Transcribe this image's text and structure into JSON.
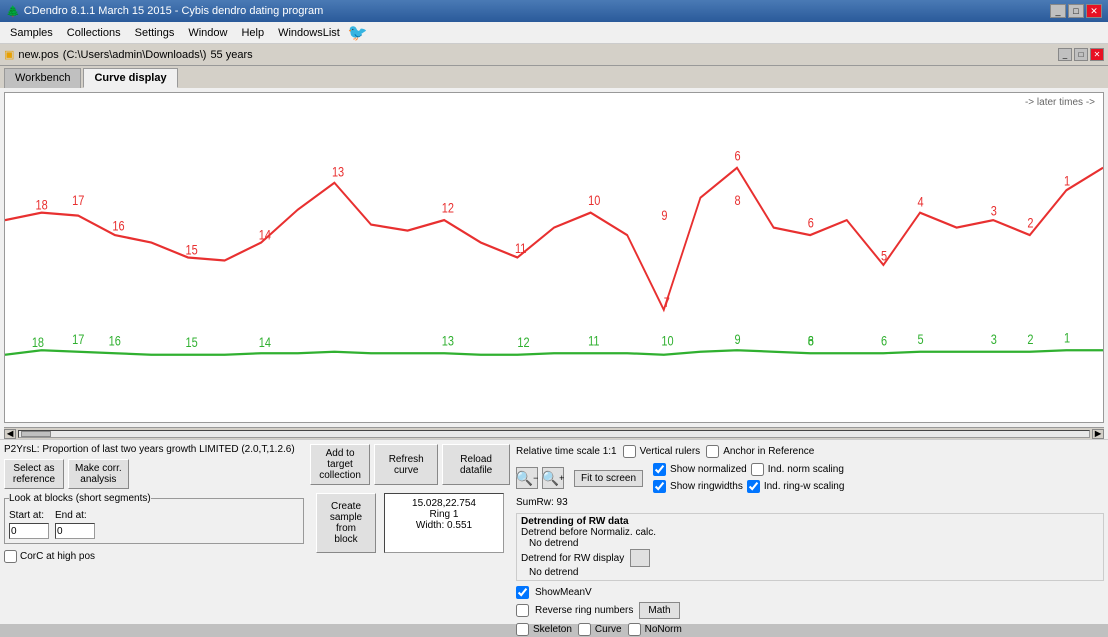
{
  "titlebar": {
    "title": "CDendro 8.1.1  March 15 2015 - Cybis dendro dating program",
    "icon": "🌲"
  },
  "menubar": {
    "items": [
      "Samples",
      "Collections",
      "Settings",
      "Window",
      "Help",
      "WindowsList"
    ]
  },
  "docbar": {
    "filename": "new.pos",
    "path": "(C:\\Users\\admin\\Downloads\\)",
    "info": "55 years"
  },
  "tabs": {
    "workbench": "Workbench",
    "curve_display": "Curve display"
  },
  "chart": {
    "later_times": "-> later times ->"
  },
  "bottom": {
    "label": "P2YrsL: Proportion of last two years growth LIMITED (2.0,T,1.2.6)",
    "select_as_reference": "Select as\nreference",
    "make_corr_analysis": "Make corr.\nanalysis",
    "add_to_target": "Add to target\ncollection",
    "refresh_curve": "Refresh curve",
    "reload_datafile": "Reload datafile",
    "relative_time_scale": "Relative time scale 1:1",
    "segments": {
      "title": "Look at blocks (short segments)",
      "start_label": "Start at:",
      "end_label": "End at:",
      "start_val": "0",
      "end_val": "0"
    },
    "create_sample": "Create\nsample\nfrom\nblock",
    "corrc_label": "CorC at high pos",
    "info": {
      "line1": "15.028,22.754",
      "line2": "Ring 1",
      "line3": "Width: 0.551"
    },
    "sumrw": "SumRw: 93",
    "vertical_rulers": "Vertical rulers",
    "anchor_ref": "Anchor in Reference",
    "show_normalized": "Show normalized",
    "ind_norm_scaling": "Ind. norm scaling",
    "show_ringwidths": "Show ringwidths",
    "ind_ringw_scaling": "Ind. ring-w scaling",
    "detrend_section": {
      "title": "Detrending of RW data",
      "before_norm": "Detrend before Normaliz. calc.",
      "no_detrend1": "No detrend",
      "for_display": "Detrend for RW display",
      "no_detrend2": "No detrend"
    },
    "show_mean_v": "ShowMeanV",
    "reverse_ring": "Reverse ring numbers",
    "math_btn": "Math",
    "skeleton": "Skeleton",
    "curve": "Curve",
    "nonorm": "NoNorm",
    "fit_screen": "Fit to screen"
  }
}
